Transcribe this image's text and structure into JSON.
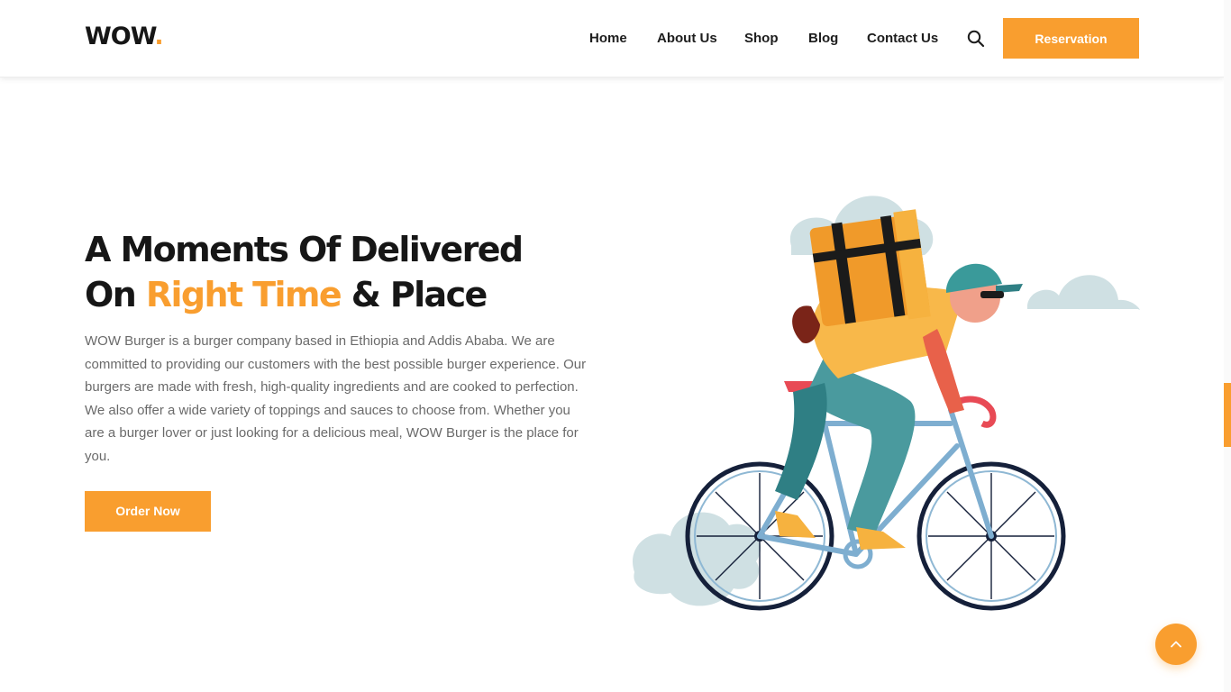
{
  "brand": {
    "name": "WOW",
    "dot": "."
  },
  "nav": {
    "items": [
      {
        "label": "Home"
      },
      {
        "label": "About Us"
      },
      {
        "label": "Shop"
      },
      {
        "label": "Blog"
      },
      {
        "label": "Contact Us"
      }
    ],
    "search_icon": "search-icon",
    "reservation_label": "Reservation"
  },
  "hero": {
    "title_line1": "A Moments Of Delivered",
    "title_on": "On",
    "title_accent": "Right Time",
    "title_end": "& Place",
    "description": "WOW Burger is a burger company based in Ethiopia and Addis Ababa. We are committed to providing our customers with the best possible burger experience. Our burgers are made with fresh, high-quality ingredients and are cooked to perfection. We also offer a wide variety of toppings and sauces to choose from. Whether you are a burger lover or just looking for a delicious meal, WOW Burger is the place for you.",
    "order_label": "Order Now",
    "illustration": "delivery-cyclist-illustration"
  },
  "back_to_top_icon": "chevron-up-icon",
  "colors": {
    "accent": "#f99e2f",
    "text": "#161616",
    "muted": "#6a6a6a",
    "cloud": "#cfe0e3"
  }
}
